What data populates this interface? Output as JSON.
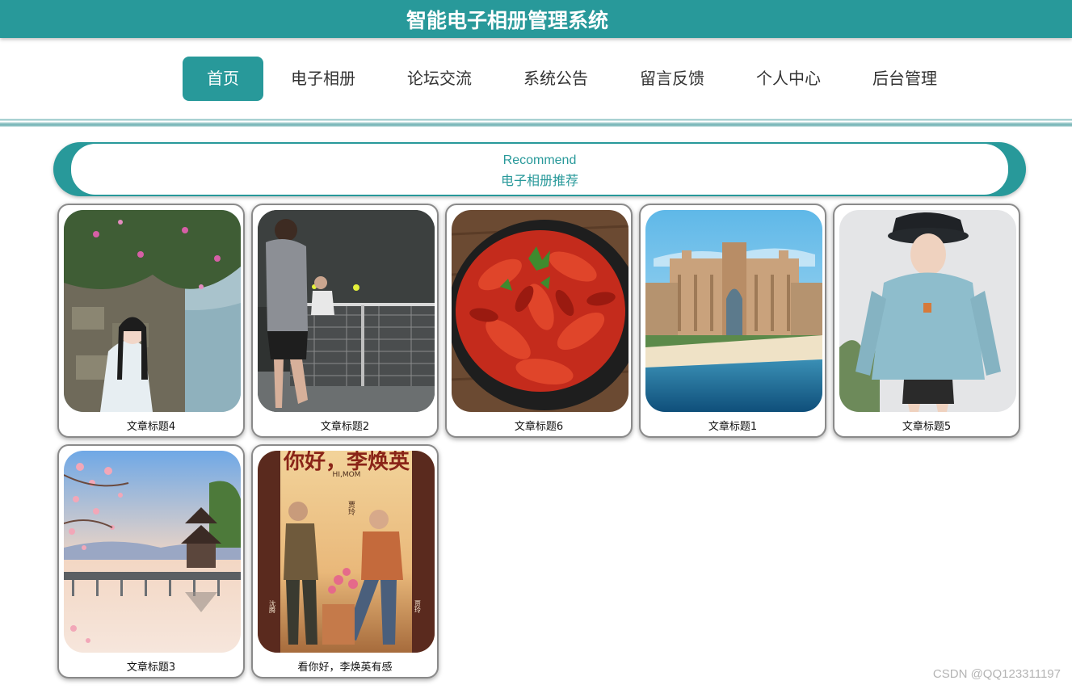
{
  "header": {
    "title": "智能电子相册管理系统"
  },
  "nav": {
    "items": [
      {
        "label": "首页",
        "active": true
      },
      {
        "label": "电子相册",
        "active": false
      },
      {
        "label": "论坛交流",
        "active": false
      },
      {
        "label": "系统公告",
        "active": false
      },
      {
        "label": "留言反馈",
        "active": false
      },
      {
        "label": "个人中心",
        "active": false
      },
      {
        "label": "后台管理",
        "active": false
      }
    ]
  },
  "recommend": {
    "en": "Recommend",
    "cn": "电子相册推荐"
  },
  "cards": [
    {
      "title": "文章标题4",
      "image": "woman-in-hanfu-by-lake-photo"
    },
    {
      "title": "文章标题2",
      "image": "tennis-players-photo"
    },
    {
      "title": "文章标题6",
      "image": "crayfish-dish-photo"
    },
    {
      "title": "文章标题1",
      "image": "resort-hotel-beach-photo"
    },
    {
      "title": "文章标题5",
      "image": "woman-in-blue-hoodie-photo"
    },
    {
      "title": "文章标题3",
      "image": "lake-pavilion-blossom-photo"
    },
    {
      "title": "看你好，李焕英有感",
      "image": "movie-poster-photo",
      "poster_text": {
        "top": "你好，李焕英",
        "latin": "HI,MOM",
        "side_left": "沈腾",
        "side_right": "贾玲",
        "director": "贾玲"
      }
    }
  ],
  "watermark": "CSDN @QQ123311197",
  "colors": {
    "accent": "#28999a",
    "text": "#333333"
  }
}
